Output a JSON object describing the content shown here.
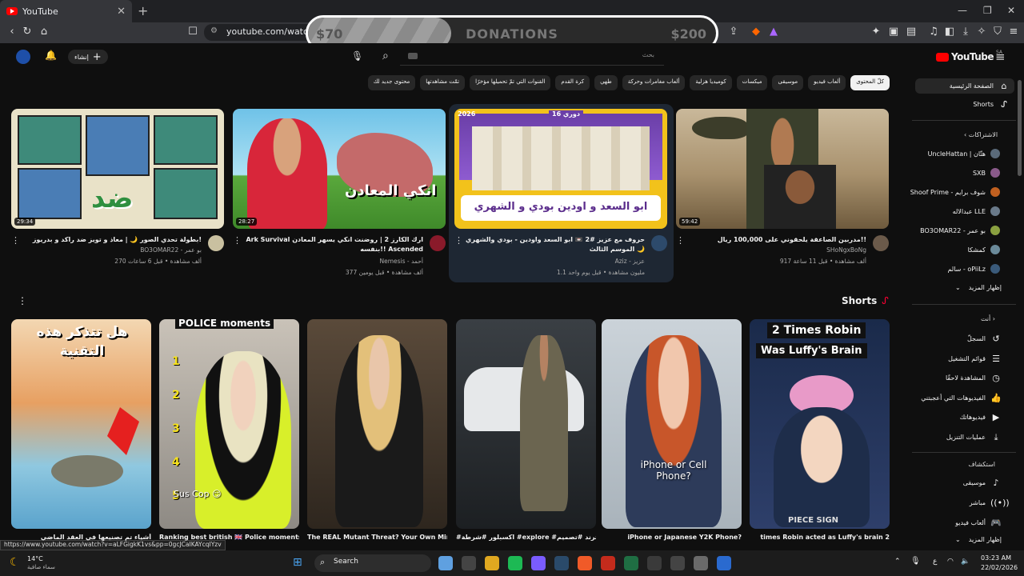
{
  "browser": {
    "tab_title": "YouTube",
    "url": "youtube.com/watch?v=",
    "status_url": "https://www.youtube.com/watch?v=aLFGigkK1vs&pp=0gcJCaIKAYcqIYzv"
  },
  "donation": {
    "current": "$70",
    "label": "DONATIONS",
    "goal": "$200",
    "progress_fraction": 0.35
  },
  "youtube": {
    "logo": "YouTube",
    "region": "SA",
    "create_label": "إنشاء",
    "search_placeholder": "بحث"
  },
  "chips": [
    "كلّ المحتوى",
    "ألعاب فيديو",
    "موسيقى",
    "ميكسات",
    "كوميديا هزلية",
    "ألعاب مغامرات وحركة",
    "طهي",
    "كرة القدم",
    "القنوات التي تمّ تحميلها مؤخرًا",
    "تمّت مشاهدتها",
    "محتوى جديد لك"
  ],
  "sidebar": {
    "home": "الصفحة الرئيسية",
    "shorts": "Shorts",
    "subs_header": "الاشتراكات",
    "subs": [
      "UncleHattan | هتّان",
      "SXB",
      "Shoof Prime - شوف برايم",
      "عبدالاله LLE",
      "BO3OMAR22 - بو عمر",
      "كمشكا",
      "سالم - oPiiLz"
    ],
    "show_more": "إظهار المزيد",
    "you_header": "أنت",
    "you": [
      "السجلّ",
      "قوائم التشغيل",
      "المشاهدة لاحقًا",
      "الفيديوهات التي أعجبتني",
      "فيديوهاتك",
      "عمليات التنزيل"
    ],
    "explore_header": "استكشاف",
    "explore": [
      "موسيقى",
      "مباشر",
      "ألعاب فيديو"
    ],
    "show_more2": "إظهار المزيد"
  },
  "videos": [
    {
      "title": "مدربين الصاعقة يلحقوني على 100,000 ريال!!",
      "channel": "SHoNgxBoNg",
      "meta": "917 ألف مشاهدة • قبل 11 ساعة",
      "duration": "59:42"
    },
    {
      "title": "حروف مع عزيز #2 📼 ابو السعد واودين - بودي والشهري 🌙 الموسم الثالث",
      "channel": "Aziz - عزيز",
      "meta": "1.1 مليون مشاهدة • قبل يوم واحد",
      "duration": ""
    },
    {
      "title": "Ark Survival ارك الكارز 2 | روضنت انكي يسهر المعادن بنفسه!! Ascended",
      "channel": "Nemesis - أحمد",
      "meta": "377 ألف مشاهدة • قبل يومين",
      "duration": "28:27"
    },
    {
      "title": "بطولة تحدي الصور 🌙 | معاذ و تويز ضد راكد و بدريوز!",
      "channel": "BO3OMAR22 - بو عمر",
      "meta": "270 ألف مشاهدة • قبل 6 ساعات",
      "duration": "29:34"
    }
  ],
  "thumb_text": {
    "v2_badge": "دوري 16",
    "v2_year": "2026",
    "v2_names": "ابو السعد و اودين بودي و الشهري",
    "v3_title": "انكي المعادن",
    "v4_word": "ضد"
  },
  "shorts_header": "Shorts",
  "shorts": [
    {
      "title": "times Robin acted as Luffy's brain 2",
      "overlay_top": "2 Times Robin",
      "overlay_top2": "Was Luffy's Brain",
      "overlay_bottom": "PIECE SIGN"
    },
    {
      "title": "iPhone or Japanese Y2K Phone?",
      "overlay": "iPhone or Cell Phone?"
    },
    {
      "title": "#اكسبلور #شرطة #explore #ترند #تصميم",
      "overlay": ""
    },
    {
      "title": "The REAL Mutant Threat? Your Own Mind | The New Mutants Explained",
      "overlay": ""
    },
    {
      "title": "Ranking best british 🇬🇧 Police moments",
      "overlay_top": "POLICE moments",
      "overlay_bottom": "Sus Cop 😏",
      "numbers": [
        "1",
        "2",
        "3",
        "4",
        "5"
      ]
    },
    {
      "title": "أشياء تم تصنيعها في العقد الماضي",
      "overlay": "هل تتذكر هذه التقنية"
    }
  ],
  "taskbar": {
    "weather_temp": "14°C",
    "weather_desc": "سماء صافية",
    "search": "Search",
    "time": "03:23 AM",
    "date": "22/02/2026",
    "lang": "ع"
  },
  "colors": {
    "accent": "#ff0000",
    "bg": "#0f0f0f",
    "chip": "#272727"
  }
}
